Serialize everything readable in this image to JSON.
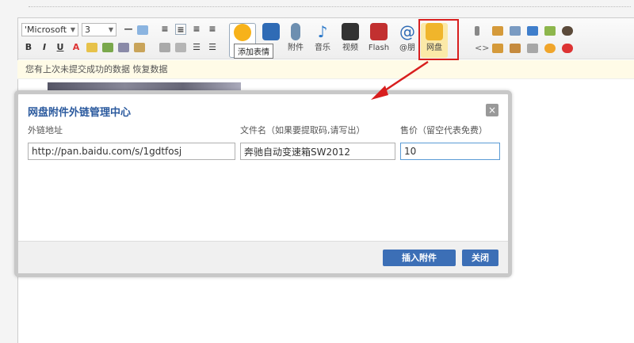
{
  "toolbar": {
    "font_family": "'Microsoft",
    "font_size": "3",
    "items": [
      {
        "label": "添加表情",
        "icon": "smiley-icon",
        "color": "#f7b21a"
      },
      {
        "label": "",
        "icon": "image-icon",
        "color": "#2f6bb5"
      },
      {
        "label": "附件",
        "icon": "paperclip-icon",
        "color": "#6d8fb0"
      },
      {
        "label": "音乐",
        "icon": "music-note-icon",
        "color": "#2a78c9"
      },
      {
        "label": "视频",
        "icon": "film-icon",
        "color": "#333333"
      },
      {
        "label": "Flash",
        "icon": "flash-icon",
        "color": "#c23030"
      },
      {
        "label": "@朋",
        "icon": "at-icon",
        "color": "#2f6bb5"
      },
      {
        "label": "网盘",
        "icon": "folder-icon",
        "color": "#f0b52b"
      }
    ],
    "tooltip": "添加表情"
  },
  "notice": {
    "text": "您有上次未提交成功的数据 恢复数据"
  },
  "dialog": {
    "title": "网盘附件外链管理中心",
    "labels": {
      "link": "外链地址",
      "filename": "文件名（如果要提取码,请写出）",
      "price": "售价（留空代表免费）"
    },
    "values": {
      "link": "http://pan.baidu.com/s/1gdtfosj",
      "filename": "奔驰自动变速箱SW2012",
      "price": "10"
    },
    "insert_button": "插入附件",
    "close_button": "关闭",
    "close_icon": "×"
  },
  "colors": {
    "accent": "#3c6fb6",
    "highlight": "#d81e1e",
    "title": "#2b5a9e"
  }
}
